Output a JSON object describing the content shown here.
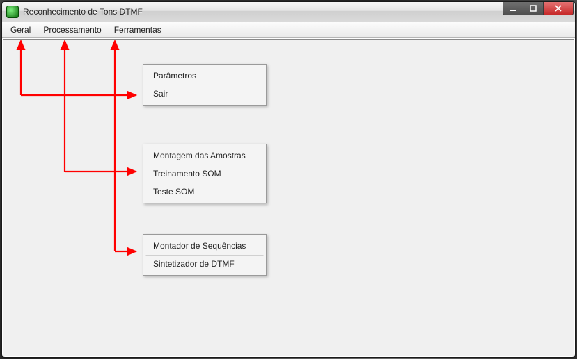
{
  "window": {
    "title": "Reconhecimento de Tons DTMF"
  },
  "menubar": {
    "geral": "Geral",
    "processamento": "Processamento",
    "ferramentas": "Ferramentas"
  },
  "menus": {
    "geral": {
      "parametros": "Parâmetros",
      "sair": "Sair"
    },
    "processamento": {
      "montagem": "Montagem das Amostras",
      "treinamento": "Treinamento SOM",
      "teste": "Teste SOM"
    },
    "ferramentas": {
      "montador": "Montador de Sequências",
      "sintetizador": "Sintetizador de DTMF"
    }
  },
  "colors": {
    "arrow": "#ff0000"
  }
}
